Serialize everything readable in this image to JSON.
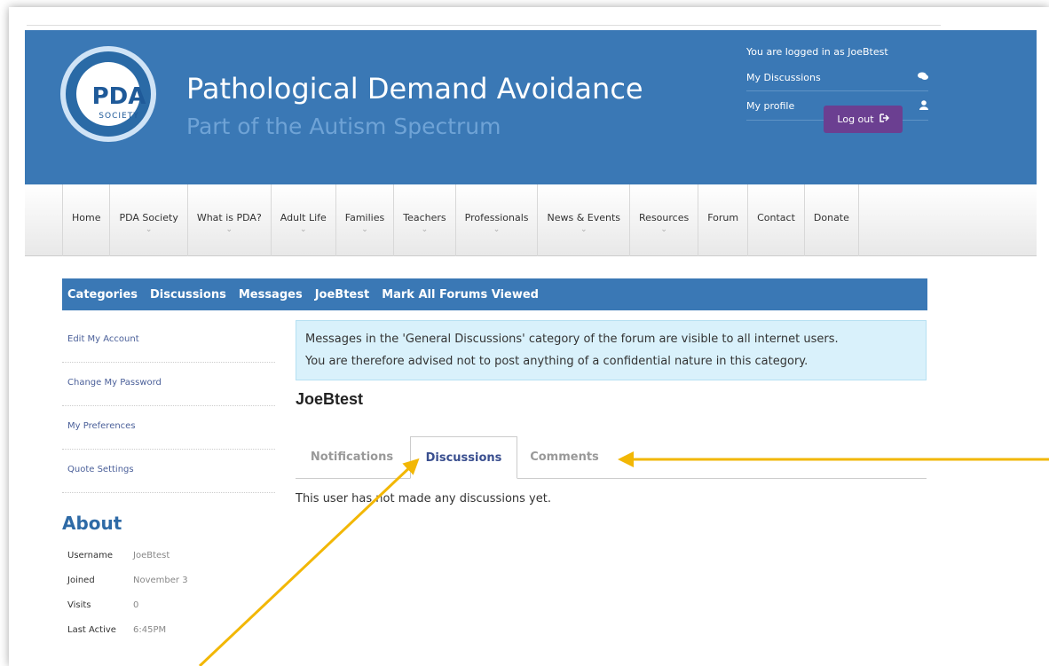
{
  "header": {
    "logo_text": "PDA",
    "logo_sub": "SOCIETY",
    "title": "Pathological Demand Avoidance",
    "tagline": "Part of the Autism Spectrum",
    "logged_in": "You are logged in as JoeBtest",
    "my_discussions": "My Discussions",
    "my_profile": "My profile",
    "logout": "Log out"
  },
  "nav": {
    "items": [
      {
        "label": "Home",
        "chevron": ""
      },
      {
        "label": "PDA Society",
        "chevron": "⌄"
      },
      {
        "label": "What is PDA?",
        "chevron": "⌄"
      },
      {
        "label": "Adult Life",
        "chevron": "⌄"
      },
      {
        "label": "Families",
        "chevron": "⌄"
      },
      {
        "label": "Teachers",
        "chevron": "⌄"
      },
      {
        "label": "Professionals",
        "chevron": "⌄"
      },
      {
        "label": "News & Events",
        "chevron": "⌄"
      },
      {
        "label": "Resources",
        "chevron": "⌄"
      },
      {
        "label": "Forum",
        "chevron": ""
      },
      {
        "label": "Contact",
        "chevron": ""
      },
      {
        "label": "Donate",
        "chevron": ""
      }
    ]
  },
  "forum_nav": {
    "categories": "Categories",
    "discussions": "Discussions",
    "messages": "Messages",
    "user": "JoeBtest",
    "mark_all": "Mark All Forums Viewed"
  },
  "sidebar": {
    "links": [
      "Edit My Account",
      "Change My Password",
      "My Preferences",
      "Quote Settings"
    ]
  },
  "about": {
    "title": "About",
    "rows": [
      {
        "key": "Username",
        "value": "JoeBtest"
      },
      {
        "key": "Joined",
        "value": "November 3"
      },
      {
        "key": "Visits",
        "value": "0"
      },
      {
        "key": "Last Active",
        "value": "6:45PM"
      }
    ]
  },
  "notice": {
    "line1": "Messages in the 'General Discussions' category of the forum are visible to all internet users.",
    "line2": "You are therefore advised not to post anything of a confidential nature in this category."
  },
  "profile": {
    "name": "JoeBtest",
    "tabs": [
      "Notifications",
      "Discussions",
      "Comments"
    ],
    "empty_message": "This user has not made any discussions yet."
  },
  "colors": {
    "brand_blue": "#3a78b5",
    "logout_purple": "#6b3f91",
    "annotation_arrow": "#f2b705"
  }
}
